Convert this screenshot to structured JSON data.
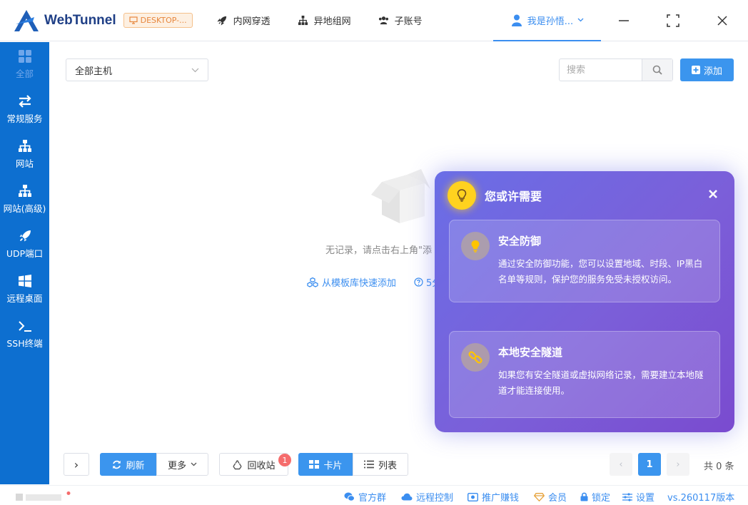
{
  "app": {
    "name": "WebTunnel",
    "device": "DESKTOP-..."
  },
  "nav": [
    {
      "label": "内网穿透",
      "icon": "rocket-icon"
    },
    {
      "label": "异地组网",
      "icon": "sitemap-icon"
    },
    {
      "label": "子账号",
      "icon": "users-icon"
    }
  ],
  "user": {
    "name": "我是孙悟..."
  },
  "sidebar": [
    {
      "label": "全部",
      "icon": "grid-icon",
      "active": true
    },
    {
      "label": "常规服务",
      "icon": "exchange-icon"
    },
    {
      "label": "网站",
      "icon": "sitemap-icon"
    },
    {
      "label": "网站(高级)",
      "icon": "sitemap-icon"
    },
    {
      "label": "UDP端口",
      "icon": "rocket-icon"
    },
    {
      "label": "远程桌面",
      "icon": "windows-icon"
    },
    {
      "label": "SSH终端",
      "icon": "terminal-icon"
    }
  ],
  "filter": {
    "host_select": "全部主机"
  },
  "search": {
    "placeholder": "搜索"
  },
  "add_button": "添加",
  "empty": {
    "text": "无记录，请点击右上角\"添",
    "template_link": "从模板库快速添加",
    "help_link": "5分"
  },
  "popup": {
    "title": "您或许需要",
    "cards": [
      {
        "title": "安全防御",
        "icon": "bulb-icon",
        "desc": "通过安全防御功能，您可以设置地域、时段、IP黑白名单等规则，保护您的服务免受未授权访问。"
      },
      {
        "title": "本地安全隧道",
        "icon": "link-icon",
        "desc": "如果您有安全隧道或虚拟网络记录，需要建立本地隧道才能连接使用。"
      }
    ]
  },
  "toolbar": {
    "expand": "›",
    "refresh": "刷新",
    "more": "更多",
    "recycle": "回收站",
    "recycle_count": "1",
    "card_view": "卡片",
    "list_view": "列表"
  },
  "pagination": {
    "current": "1",
    "prev": "‹",
    "next": "›",
    "total": "共 0 条"
  },
  "status": {
    "group": "官方群",
    "remote": "远程控制",
    "promo": "推广赚钱",
    "vip": "会员",
    "lock": "锁定",
    "settings": "设置",
    "version": "vs.260117版本"
  },
  "colors": {
    "primary": "#3b95ee",
    "sidebar": "#0d6fd0",
    "popup": "#7b5fd9",
    "badge": "#f56c6c"
  }
}
